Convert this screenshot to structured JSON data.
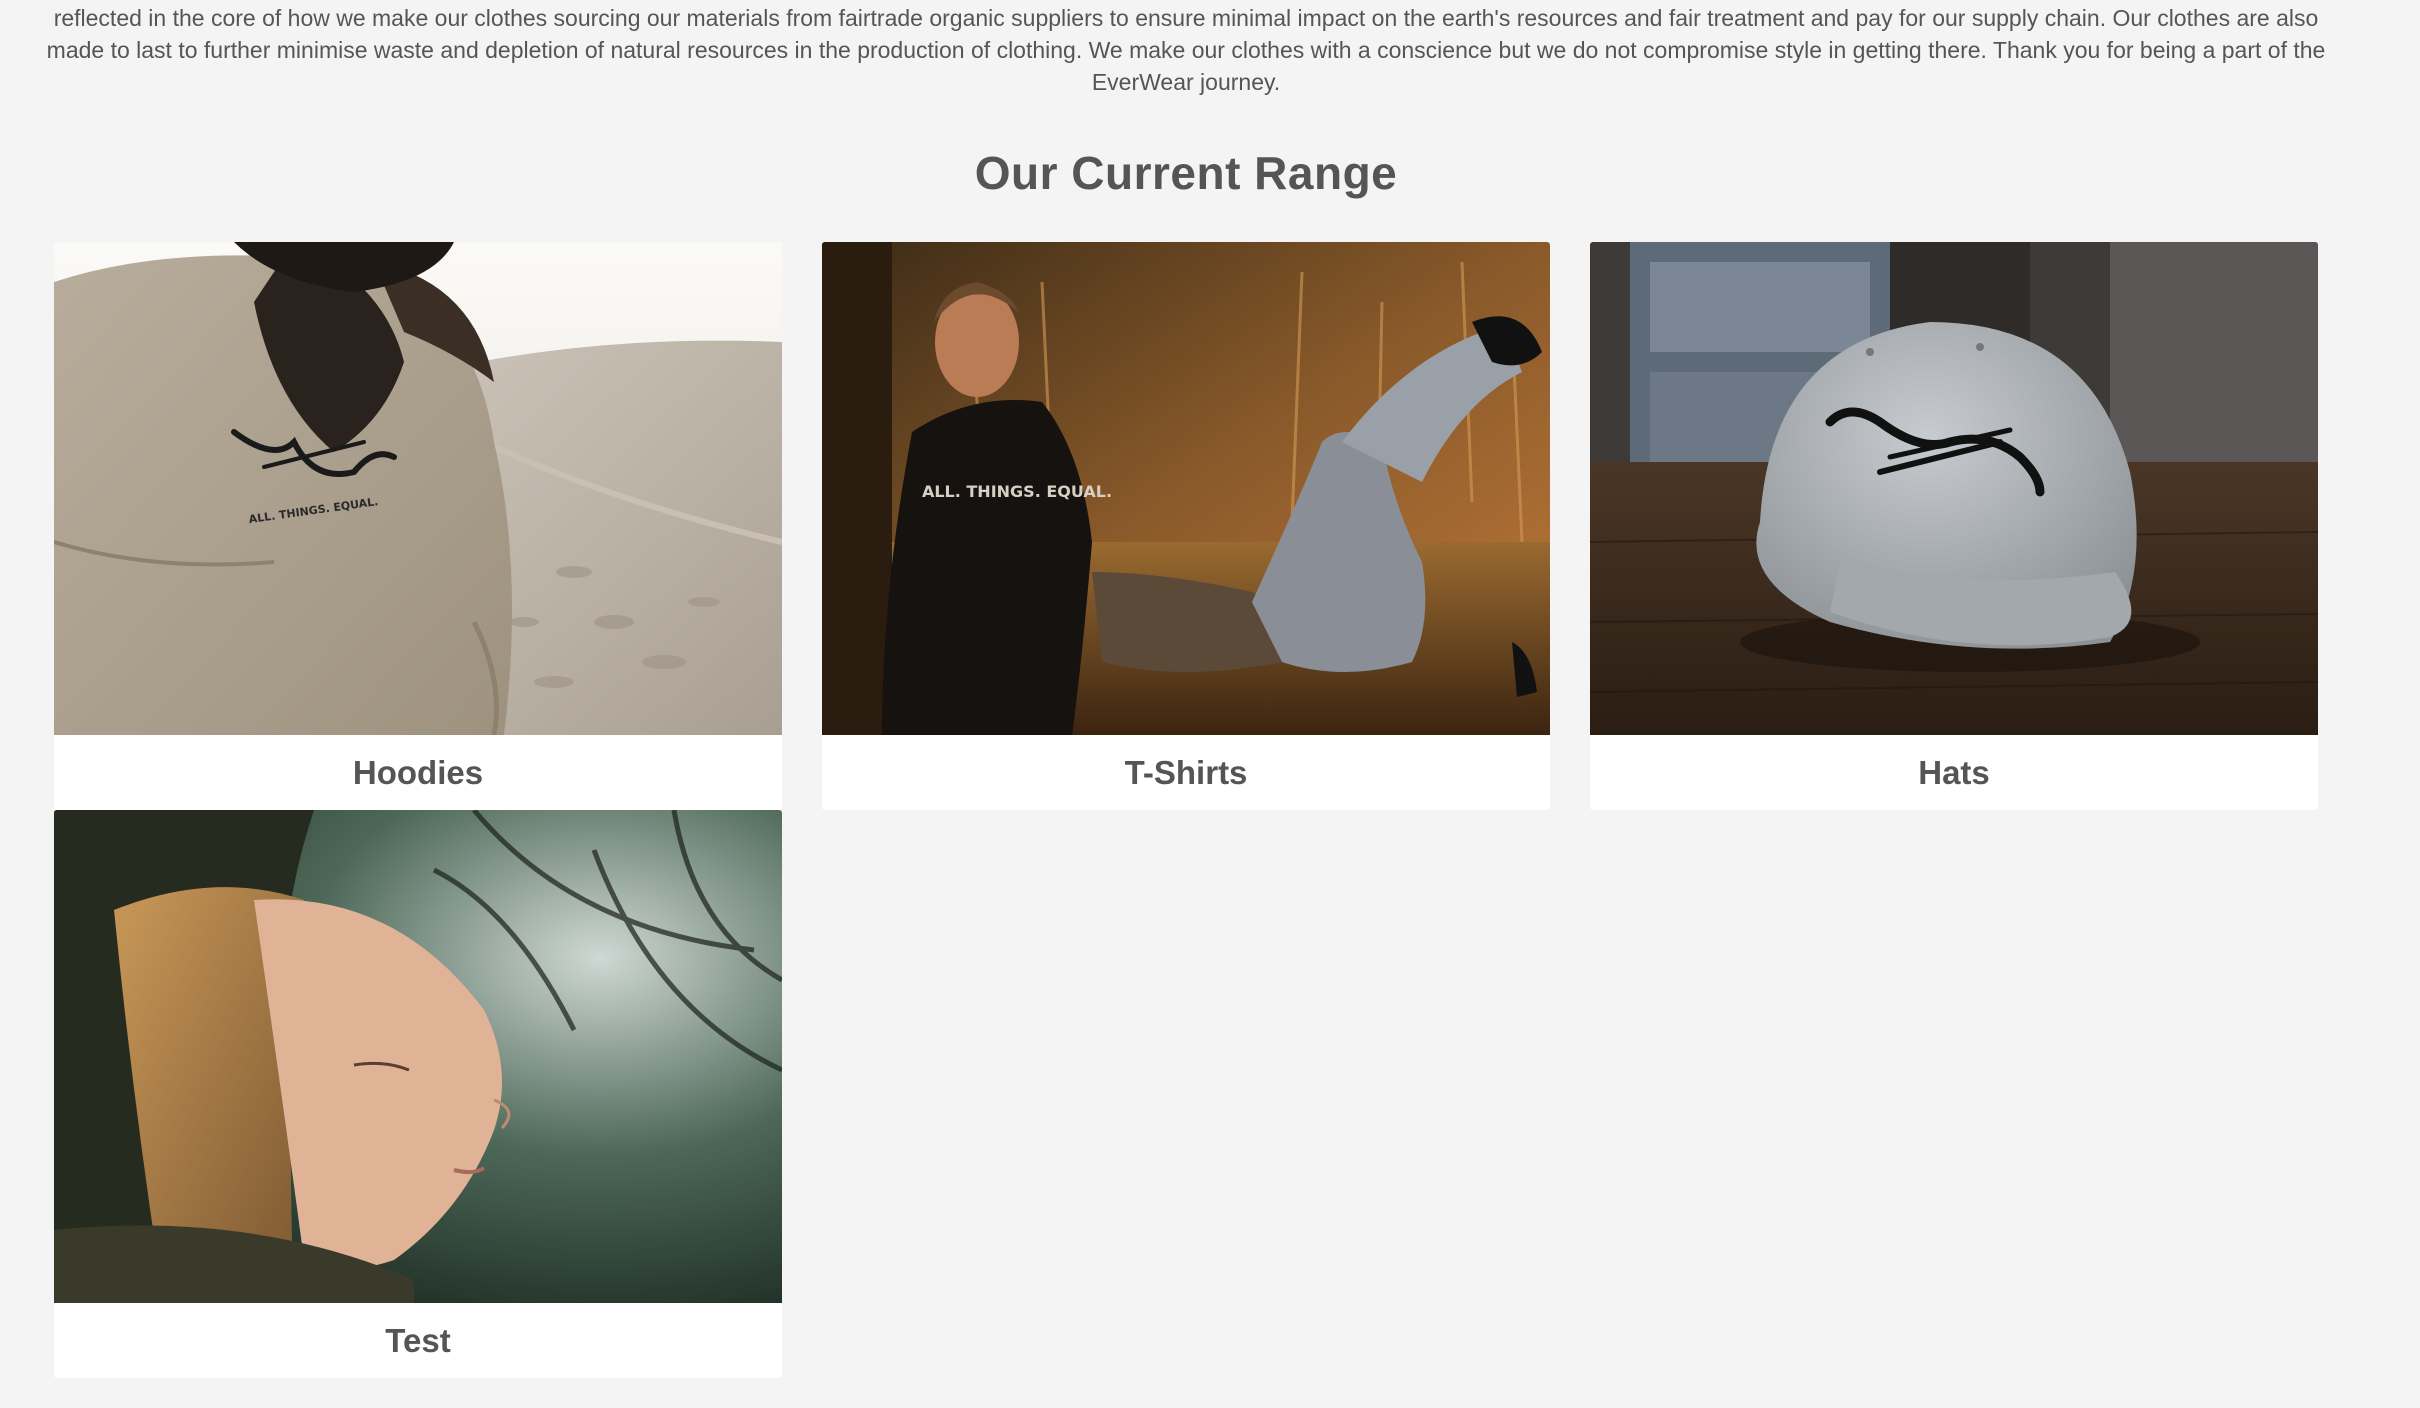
{
  "intro": {
    "text": "reflected in the core of how we make our clothes sourcing our materials from fairtrade organic suppliers to ensure minimal impact on the earth's resources and fair treatment and pay for our supply chain. Our clothes are also made to last to further minimise waste and depletion of natural resources in the production of clothing. We make our clothes with a conscience but we do not compromise style in getting there. Thank you for being a part of the EverWear journey."
  },
  "range": {
    "title": "Our Current Range",
    "products": [
      {
        "label": "Hoodies",
        "image": "woman-in-beige-hoodie-desert-photo",
        "print_text": "ALL. THINGS. EQUAL."
      },
      {
        "label": "T-Shirts",
        "image": "couple-sitting-in-field-photo",
        "print_text": "ALL. THINGS. EQUAL."
      },
      {
        "label": "Hats",
        "image": "grey-cap-on-table-photo"
      },
      {
        "label": "Test",
        "image": "woman-in-forest-profile-photo"
      }
    ]
  },
  "colors": {
    "background": "#f4f4f4",
    "text": "#555555",
    "card": "#ffffff"
  }
}
